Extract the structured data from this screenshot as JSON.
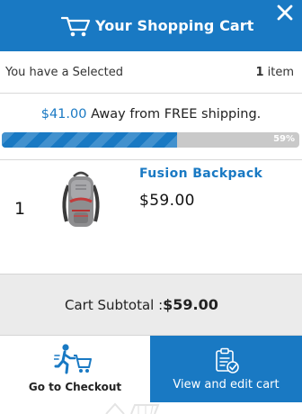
{
  "header": {
    "title": "Your Shopping Cart",
    "icons": {
      "cart": "cart-icon",
      "close": "close-icon"
    }
  },
  "summary": {
    "left_text": "You have a Selected",
    "count": "1",
    "count_unit": "item"
  },
  "shipping": {
    "amount": "$41.00",
    "message": "Away from FREE shipping.",
    "progress_percent": 59,
    "progress_label": "59%"
  },
  "items": [
    {
      "qty": "1",
      "name": "Fusion Backpack",
      "price": "$59.00",
      "image_icon": "backpack-image"
    }
  ],
  "subtotal": {
    "label": "Cart Subtotal :",
    "value": "$59.00"
  },
  "actions": {
    "checkout_label": "Go to Checkout",
    "view_label": "View and edit cart",
    "checkout_icon": "running-cart-icon",
    "view_icon": "clipboard-check-icon"
  },
  "colors": {
    "brand": "#1979c3",
    "progress_track": "#c9c9c9",
    "subtotal_bg": "#ebebeb"
  }
}
